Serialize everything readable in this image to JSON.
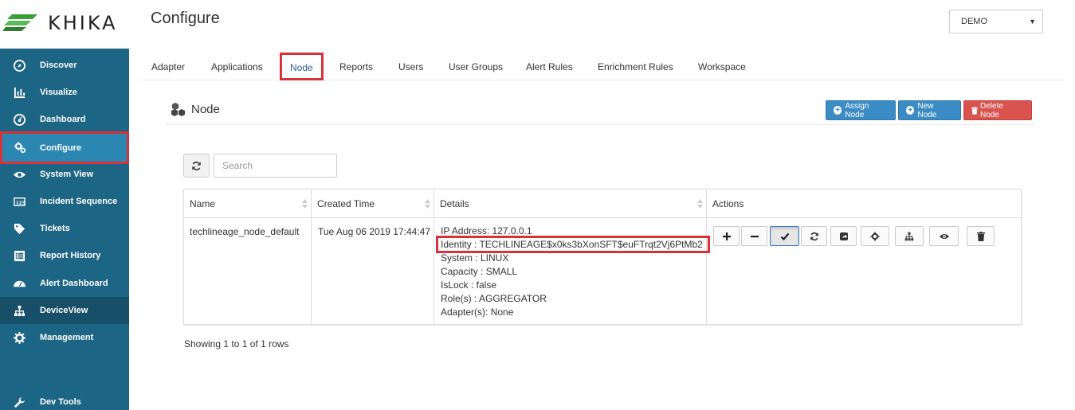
{
  "brand": {
    "name": "KHIKA",
    "mark": "khika-logo-mark"
  },
  "sidebar": {
    "items": [
      {
        "label": "Discover",
        "icon": "compass-icon"
      },
      {
        "label": "Visualize",
        "icon": "bar-chart-icon"
      },
      {
        "label": "Dashboard",
        "icon": "dashboard-gauge-icon"
      },
      {
        "label": "Configure",
        "icon": "cogs-icon",
        "active": true
      },
      {
        "label": "System View",
        "icon": "eye-icon"
      },
      {
        "label": "Incident Sequence",
        "icon": "sequence-icon"
      },
      {
        "label": "Tickets",
        "icon": "tag-icon"
      },
      {
        "label": "Report History",
        "icon": "list-icon"
      },
      {
        "label": "Alert Dashboard",
        "icon": "gauge-icon"
      },
      {
        "label": "DeviceView",
        "icon": "sitemap-icon"
      },
      {
        "label": "Management",
        "icon": "gear-icon"
      },
      {
        "label": "Dev Tools",
        "icon": "wrench-icon"
      }
    ]
  },
  "header": {
    "title": "Configure",
    "tenant": "DEMO"
  },
  "tabs": [
    "Adapter",
    "Applications",
    "Node",
    "Reports",
    "Users",
    "User Groups",
    "Alert Rules",
    "Enrichment Rules",
    "Workspace"
  ],
  "active_tab": "Node",
  "section": {
    "title": "Node",
    "buttons": {
      "assign": "Assign Node",
      "new": "New Node",
      "delete": "Delete Node"
    }
  },
  "search": {
    "placeholder": "Search",
    "value": ""
  },
  "table": {
    "columns": [
      "Name",
      "Created Time",
      "Details",
      "Actions"
    ],
    "rows": [
      {
        "name": "techlineage_node_default",
        "created": "Tue Aug 06 2019 17:44:47",
        "details": [
          "IP Address: 127.0.0.1",
          "Identity : TECHLINEAGE$x0ks3bXonSFT$euFTrqt2Vj6PtMb2",
          "System : LINUX",
          "Capacity : SMALL",
          "IsLock : false",
          "Role(s) : AGGREGATOR",
          "Adapter(s): None"
        ]
      }
    ],
    "actions": [
      "plus-icon",
      "minus-icon",
      "check-icon",
      "refresh-icon",
      "share-icon",
      "gear-icon",
      "sitemap-icon",
      "eye-icon",
      "trash-icon"
    ]
  },
  "pagination": {
    "info": "Showing 1 to 1 of 1 rows"
  },
  "colors": {
    "sidebar": "#1d6584",
    "active_nav": "#2b87b1",
    "primary": "#3b8bc4",
    "danger": "#d9534f",
    "highlight": "#d6323a"
  }
}
